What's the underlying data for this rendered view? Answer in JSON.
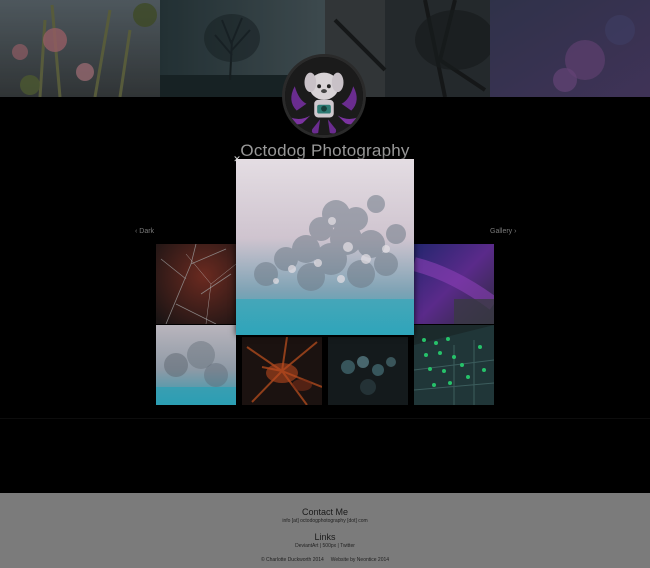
{
  "site": {
    "title": "Octodog Photography"
  },
  "gallery_nav": {
    "prev_label": "‹ Dark",
    "next_label": "Gallery ›"
  },
  "lightbox": {
    "close_glyph": "✕"
  },
  "footer": {
    "contact_heading": "Contact Me",
    "contact_email": "info [at] octodogphotography [dot] com",
    "links_heading": "Links",
    "links": [
      "DeviantArt",
      "500px",
      "Twitter"
    ],
    "link_separator": "|",
    "copyright": "© Charlotte Duckworth 2014",
    "credit": "Website by Neontice 2014"
  },
  "colors": {
    "background": "#000000",
    "footer_bg": "#7b7b7b",
    "accent_purple": "#6a2c8f"
  }
}
